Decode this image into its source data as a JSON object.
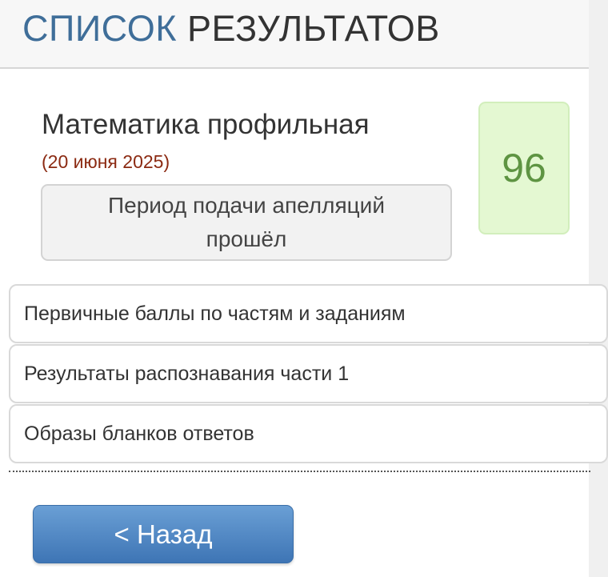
{
  "header": {
    "title_accent": "СПИСОК",
    "title_rest": "РЕЗУЛЬТАТОВ"
  },
  "result": {
    "subject": "Математика профильная",
    "date": "(20 июня 2025)",
    "appeal_status": "Период подачи апелляций прошёл",
    "score": "96"
  },
  "links": [
    {
      "label": "Первичные баллы по частям и заданиям"
    },
    {
      "label": "Результаты распознавания части 1"
    },
    {
      "label": "Образы бланков ответов"
    }
  ],
  "back_button": {
    "label": "< Назад"
  },
  "colors": {
    "accent": "#3f6e99",
    "date": "#8b2a12",
    "score_bg": "#e4f8d2",
    "score_text": "#5e9442",
    "button": "#4a85c6"
  }
}
